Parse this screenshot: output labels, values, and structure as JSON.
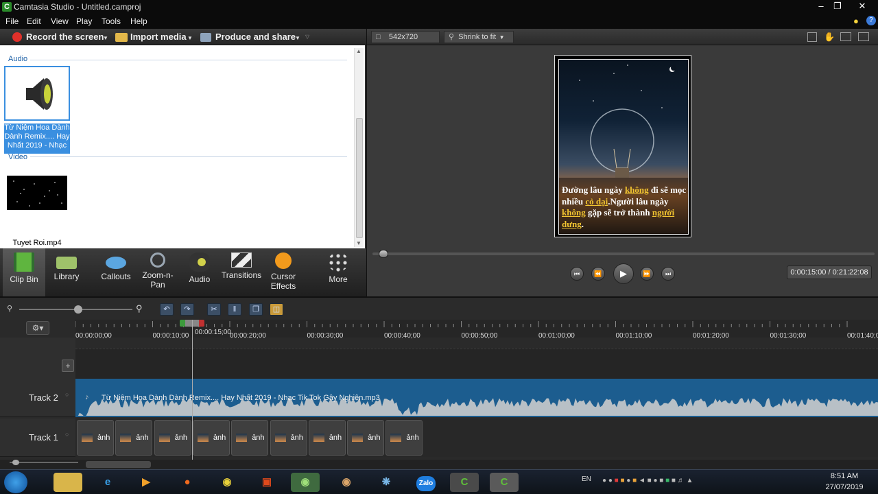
{
  "window": {
    "title": "Camtasia Studio - Untitled.camproj",
    "app_icon_letter": "C"
  },
  "menu": [
    "File",
    "Edit",
    "View",
    "Play",
    "Tools",
    "Help"
  ],
  "toolbar": {
    "record": "Record the screen",
    "import": "Import media",
    "produce": "Produce and share"
  },
  "clipbin": {
    "audio_label": "Audio",
    "audio_clip_name": "Từ Niệm Hoa Dành Dành Remix.... Hay Nhất 2019 - Nhạc",
    "video_label": "Video",
    "video_clip_name": "Tuyet Roi.mp4"
  },
  "tabs": [
    {
      "label": "Clip Bin",
      "icon": "filmstrip-icon"
    },
    {
      "label": "Library",
      "icon": "folder-icon"
    },
    {
      "label": "Callouts",
      "icon": "speech-bubble-icon"
    },
    {
      "label": "Zoom-n-Pan",
      "icon": "magnifier-icon"
    },
    {
      "label": "Audio",
      "icon": "speaker-icon"
    },
    {
      "label": "Transitions",
      "icon": "transition-icon"
    },
    {
      "label": "Cursor Effects",
      "icon": "cursor-icon"
    },
    {
      "label": "More",
      "icon": "dots-icon"
    }
  ],
  "preview": {
    "dimensions": "542x720",
    "zoom": "Shrink to fit",
    "quote_parts": [
      {
        "text": "Đường lâu ngày ",
        "hl": false
      },
      {
        "text": "không",
        "hl": true
      },
      {
        "text": " đi sẽ mọc nhiều ",
        "hl": false
      },
      {
        "text": "cỏ dại",
        "hl": true
      },
      {
        "text": ".Người lâu ngày ",
        "hl": false
      },
      {
        "text": "không",
        "hl": true
      },
      {
        "text": " gặp sẽ trở thành ",
        "hl": false
      },
      {
        "text": "người dưng",
        "hl": true
      },
      {
        "text": ".",
        "hl": false
      }
    ],
    "timecode": "0:00:15:00 / 0:21:22:08",
    "seek_fraction": 0.012
  },
  "timeline": {
    "ruler_ticks": [
      "00:00:00;00",
      "00:00:10;00",
      "00:00:20;00",
      "00:00:30;00",
      "00:00:40;00",
      "00:00:50;00",
      "00:01:00;00",
      "00:01:10;00",
      "00:01:20;00",
      "00:01:30;00",
      "00:01:40;00"
    ],
    "playhead_time": "00:00:15;00",
    "tracks": [
      {
        "name": "Track 2"
      },
      {
        "name": "Track 1"
      }
    ],
    "audio_clip_name": "Từ Niệm Hoa Dành Dành Remix.... Hay Nhất 2019 - Nhạc Tik Tok Gây Nghiện.mp3",
    "video_clip_label": "ảnh",
    "video_clip_count": 9
  },
  "taskbar": {
    "language": "EN",
    "time": "8:51 AM",
    "date": "27/07/2019",
    "apps": [
      "start-icon",
      "file-explorer-icon",
      "internet-explorer-icon",
      "media-player-icon",
      "firefox-icon",
      "chrome-icon",
      "foxit-icon",
      "coccoc-icon",
      "paint-icon",
      "app-icon",
      "zalo-icon",
      "camtasia-icon",
      "camtasia-icon"
    ],
    "zalo_label": "Zalo"
  }
}
